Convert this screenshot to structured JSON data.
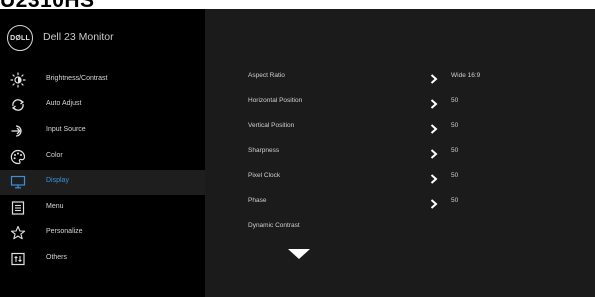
{
  "page_heading": "U2310HS",
  "brand": {
    "logo_text": "DØLL",
    "title": "Dell 23 Monitor"
  },
  "sidebar": {
    "items": [
      {
        "label": "Brightness/Contrast",
        "icon": "brightness-icon"
      },
      {
        "label": "Auto Adjust",
        "icon": "auto-adjust-icon"
      },
      {
        "label": "Input Source",
        "icon": "input-source-icon"
      },
      {
        "label": "Color",
        "icon": "color-icon"
      },
      {
        "label": "Display",
        "icon": "display-icon",
        "active": true
      },
      {
        "label": "Menu",
        "icon": "menu-icon"
      },
      {
        "label": "Personalize",
        "icon": "star-icon"
      },
      {
        "label": "Others",
        "icon": "others-icon"
      }
    ]
  },
  "display_settings": {
    "rows": [
      {
        "label": "Aspect Ratio",
        "value": "Wide 16:9",
        "has_arrow": true
      },
      {
        "label": "Horizontal Position",
        "value": "50",
        "has_arrow": true
      },
      {
        "label": "Vertical Position",
        "value": "50",
        "has_arrow": true
      },
      {
        "label": "Sharpness",
        "value": "50",
        "has_arrow": true
      },
      {
        "label": "Pixel Clock",
        "value": "50",
        "has_arrow": true
      },
      {
        "label": "Phase",
        "value": "50",
        "has_arrow": true
      },
      {
        "label": "Dynamic Contrast",
        "value": "",
        "has_arrow": false
      }
    ]
  },
  "colors": {
    "active_label": "#3f8fd8",
    "sidebar_bg": "#000000",
    "content_bg": "#1b1b1b",
    "active_row_bg": "#1e1e1e",
    "text": "#cfcfcf"
  }
}
